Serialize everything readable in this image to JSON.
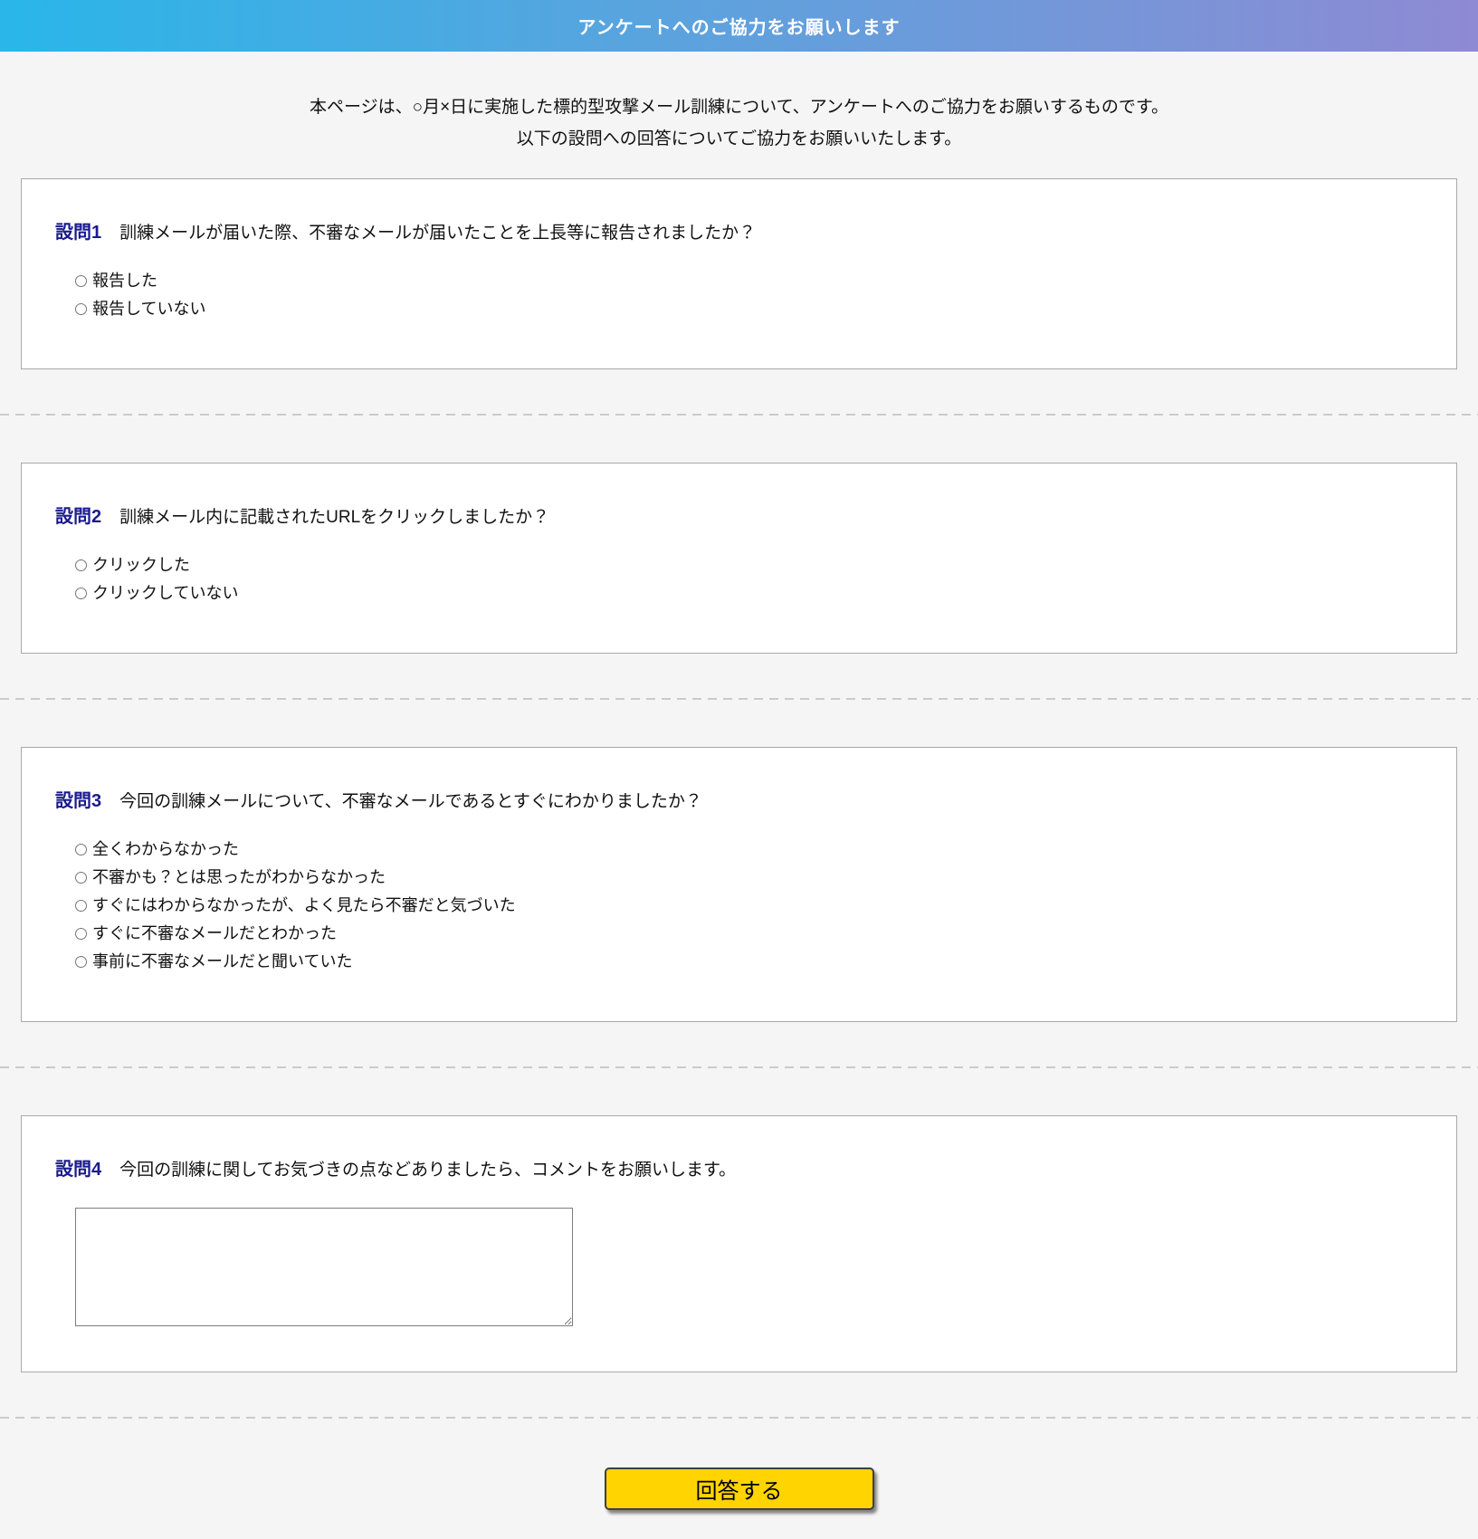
{
  "header": {
    "title": "アンケートへのご協力をお願いします",
    "gradient_start": "#29b6e9",
    "gradient_end": "#8e8ad3"
  },
  "intro": {
    "line1": "本ページは、○月×日に実施した標的型攻撃メール訓練について、アンケートへのご協力をお願いするものです。",
    "line2": "以下の設問への回答についてご協力をお願いいたします。"
  },
  "questions": [
    {
      "label": "設問1",
      "text": "訓練メールが届いた際、不審なメールが届いたことを上長等に報告されましたか？",
      "options": [
        "報告した",
        "報告していない"
      ]
    },
    {
      "label": "設問2",
      "text": "訓練メール内に記載されたURLをクリックしましたか？",
      "options": [
        "クリックした",
        "クリックしていない"
      ]
    },
    {
      "label": "設問3",
      "text": "今回の訓練メールについて、不審なメールであるとすぐにわかりましたか？",
      "options": [
        "全くわからなかった",
        "不審かも？とは思ったがわからなかった",
        "すぐにはわからなかったが、よく見たら不審だと気づいた",
        "すぐに不審なメールだとわかった",
        "事前に不審なメールだと聞いていた"
      ]
    },
    {
      "label": "設問4",
      "text": "今回の訓練に関してお気づきの点などありましたら、コメントをお願いします。",
      "comment_value": ""
    }
  ],
  "submit": {
    "label": "回答する",
    "button_color": "#ffd400"
  },
  "colors": {
    "question_label": "#1a1a8c",
    "page_background": "#f5f5f5",
    "box_border": "#a9a9a9"
  }
}
